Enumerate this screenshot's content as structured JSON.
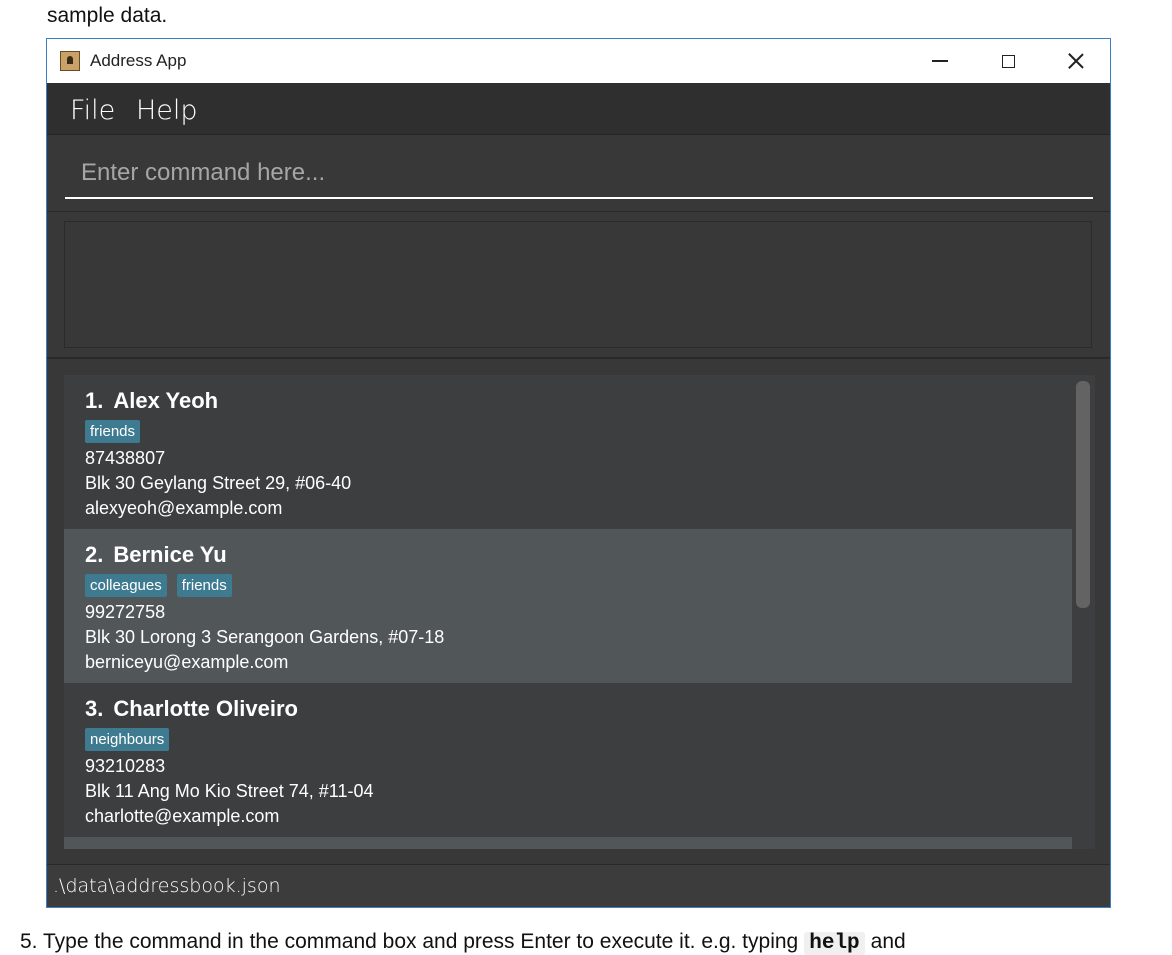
{
  "document": {
    "top_text": "sample data.",
    "bottom_prefix": "5. Type the command in the command box and press Enter to execute it. e.g. typing",
    "bottom_code": "help",
    "bottom_suffix": "and"
  },
  "window": {
    "title": "Address App",
    "icon": "address-book-icon",
    "controls": {
      "minimize_icon": "minimize-icon",
      "maximize_icon": "maximize-icon",
      "close_icon": "close-icon"
    }
  },
  "menu": {
    "items": [
      "File",
      "Help"
    ]
  },
  "command_box": {
    "placeholder": "Enter command here...",
    "value": ""
  },
  "result_display": {
    "text": ""
  },
  "persons": [
    {
      "index": "1.",
      "name": "Alex Yeoh",
      "tags": [
        "friends"
      ],
      "phone": "87438807",
      "address": "Blk 30 Geylang Street 29, #06-40",
      "email": "alexyeoh@example.com"
    },
    {
      "index": "2.",
      "name": "Bernice Yu",
      "tags": [
        "colleagues",
        "friends"
      ],
      "phone": "99272758",
      "address": "Blk 30 Lorong 3 Serangoon Gardens, #07-18",
      "email": "berniceyu@example.com"
    },
    {
      "index": "3.",
      "name": "Charlotte Oliveiro",
      "tags": [
        "neighbours"
      ],
      "phone": "93210283",
      "address": "Blk 11 Ang Mo Kio Street 74, #11-04",
      "email": "charlotte@example.com"
    }
  ],
  "status_bar": {
    "file_path": ".\\data\\addressbook.json"
  },
  "colors": {
    "window_border": "#3c7fc6",
    "background": "#383838",
    "card_odd": "#3c3e3f",
    "card_even": "#515658",
    "tag": "#3e7b91"
  }
}
